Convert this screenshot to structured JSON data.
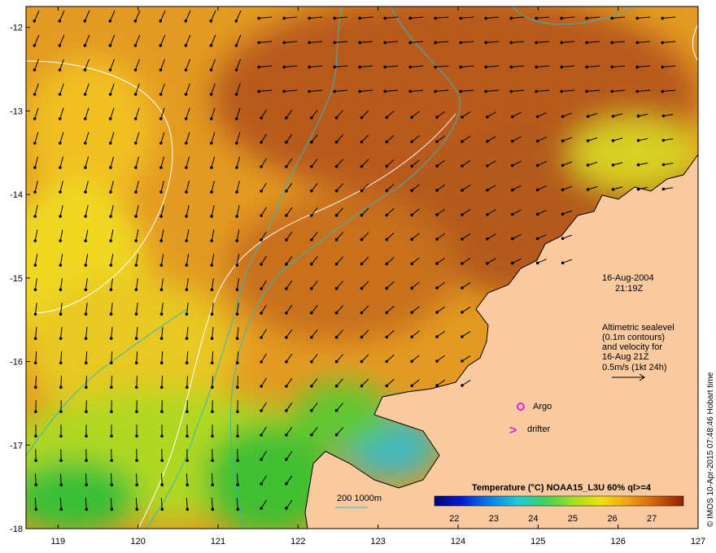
{
  "map": {
    "lon_range": [
      118.6,
      127
    ],
    "lat_range": [
      -18,
      -11.75
    ],
    "lon_ticks": [
      "119",
      "120",
      "121",
      "122",
      "123",
      "124",
      "125",
      "126",
      "127"
    ],
    "lat_ticks": [
      "-12",
      "-13",
      "-14",
      "-15",
      "-16",
      "-17",
      "-18"
    ],
    "date": "16-Aug-2004",
    "time": "21:19Z",
    "note_lines": [
      "Altimetric sealevel",
      "(0.1m contours)",
      "and velocity for",
      "16-Aug 21Z",
      "0.5m/s (1kt 24h)"
    ],
    "argo_label": "Argo",
    "drifter_label": "drifter",
    "drifter_symbol": ">",
    "bathymetry_label": "200  1000m",
    "credit": "© IMOS 10-Apr-2015 07:48:46 Hobart time"
  },
  "colorbar": {
    "title": "Temperature (°C) NOAA15_L3U 60% ql>=4",
    "range": [
      21.5,
      27.8
    ],
    "tick_labels": [
      "22",
      "23",
      "24",
      "25",
      "26",
      "27"
    ],
    "colors": [
      "#00007a",
      "#0020d0",
      "#0a80e8",
      "#22c8d8",
      "#40d060",
      "#a0e020",
      "#f0e010",
      "#f0a018",
      "#d06010",
      "#902000"
    ]
  },
  "colors": {
    "land": "#f9c9a0",
    "warm_sea": "#b85a1a",
    "mid_sea": "#e89a20",
    "cool_sea": "#f0d020",
    "cold_sea": "#40c030",
    "contour": "#ffffff",
    "bathymetry": "#30b8c0",
    "argo": "#e020e0",
    "vector": "#000000"
  }
}
